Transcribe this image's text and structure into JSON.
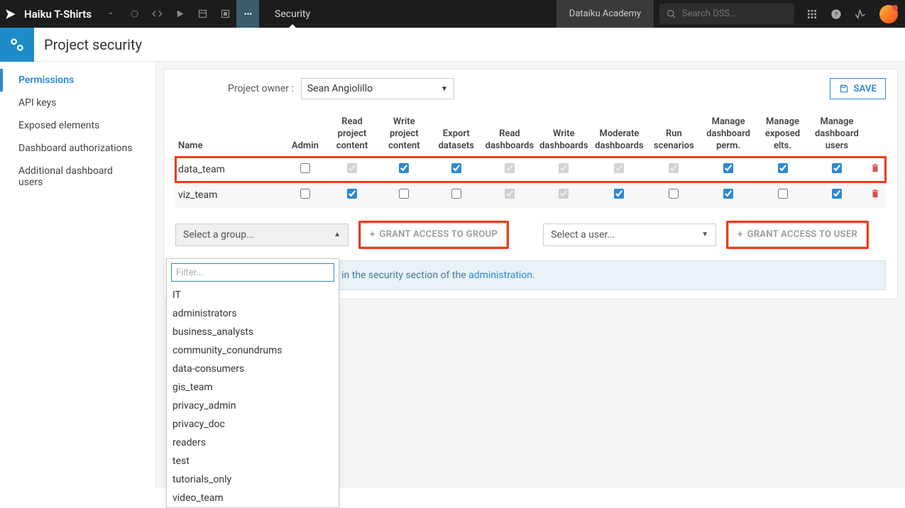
{
  "topbar": {
    "project_name": "Haiku T-Shirts",
    "tab": "Security",
    "academy": "Dataiku Academy",
    "search_placeholder": "Search DSS..."
  },
  "subheader": {
    "title": "Project security"
  },
  "sidebar": {
    "items": [
      {
        "label": "Permissions",
        "active": true
      },
      {
        "label": "API keys"
      },
      {
        "label": "Exposed elements"
      },
      {
        "label": "Dashboard authorizations"
      },
      {
        "label": "Additional dashboard users"
      }
    ]
  },
  "owner": {
    "label": "Project owner :",
    "value": "Sean Angiolillo"
  },
  "save_label": "SAVE",
  "columns": [
    "Name",
    "Admin",
    "Read project content",
    "Write project content",
    "Export datasets",
    "Read dashboards",
    "Write dashboards",
    "Moderate dashboards",
    "Run scenarios",
    "Manage dashboard perm.",
    "Manage exposed elts.",
    "Manage dashboard users"
  ],
  "rows": [
    {
      "name": "data_team",
      "admin": false,
      "read_pc": "gray",
      "write_pc": true,
      "export": true,
      "read_db": "gray",
      "write_db": "gray",
      "mod_db": "gray",
      "run": "gray",
      "mdp": true,
      "mee": true,
      "mdu": true,
      "highlight": true
    },
    {
      "name": "viz_team",
      "admin": false,
      "read_pc": true,
      "write_pc": false,
      "export": false,
      "read_db": "gray",
      "write_db": "gray",
      "mod_db": true,
      "run": false,
      "mdp": true,
      "mee": false,
      "mdu": true,
      "highlight": false
    }
  ],
  "grant": {
    "group_placeholder": "Select a group...",
    "user_placeholder": "Select a user...",
    "grant_group_label": "GRANT ACCESS TO GROUP",
    "grant_user_label": "GRANT ACCESS TO USER"
  },
  "note_text": "administration.",
  "dropdown": {
    "filter_placeholder": "Filter...",
    "options": [
      "IT",
      "administrators",
      "business_analysts",
      "community_conundrums",
      "data-consumers",
      "gis_team",
      "privacy_admin",
      "privacy_doc",
      "readers",
      "test",
      "tutorials_only",
      "video_team"
    ]
  }
}
